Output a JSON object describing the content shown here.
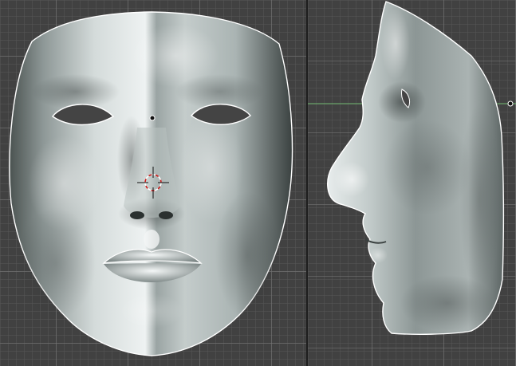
{
  "app": {
    "layout": "split-viewport",
    "viewports": [
      {
        "id": "front",
        "view": "front-orthographic",
        "object": "face-mesh"
      },
      {
        "id": "side",
        "view": "side-orthographic",
        "object": "face-mesh"
      }
    ]
  },
  "colors": {
    "viewport_bg": "#414141",
    "grid_major": "#7a7a7a",
    "grid_minor": "#5a5a5a",
    "axis_x": "#6fb86f",
    "selection_outline": "#ffffff",
    "cursor_red": "#d01515",
    "mesh_highlight": "#e9eeee",
    "mesh_shadow": "#4a5250"
  },
  "icons": {
    "cursor": "3d-cursor-icon",
    "origin": "object-origin-icon"
  }
}
